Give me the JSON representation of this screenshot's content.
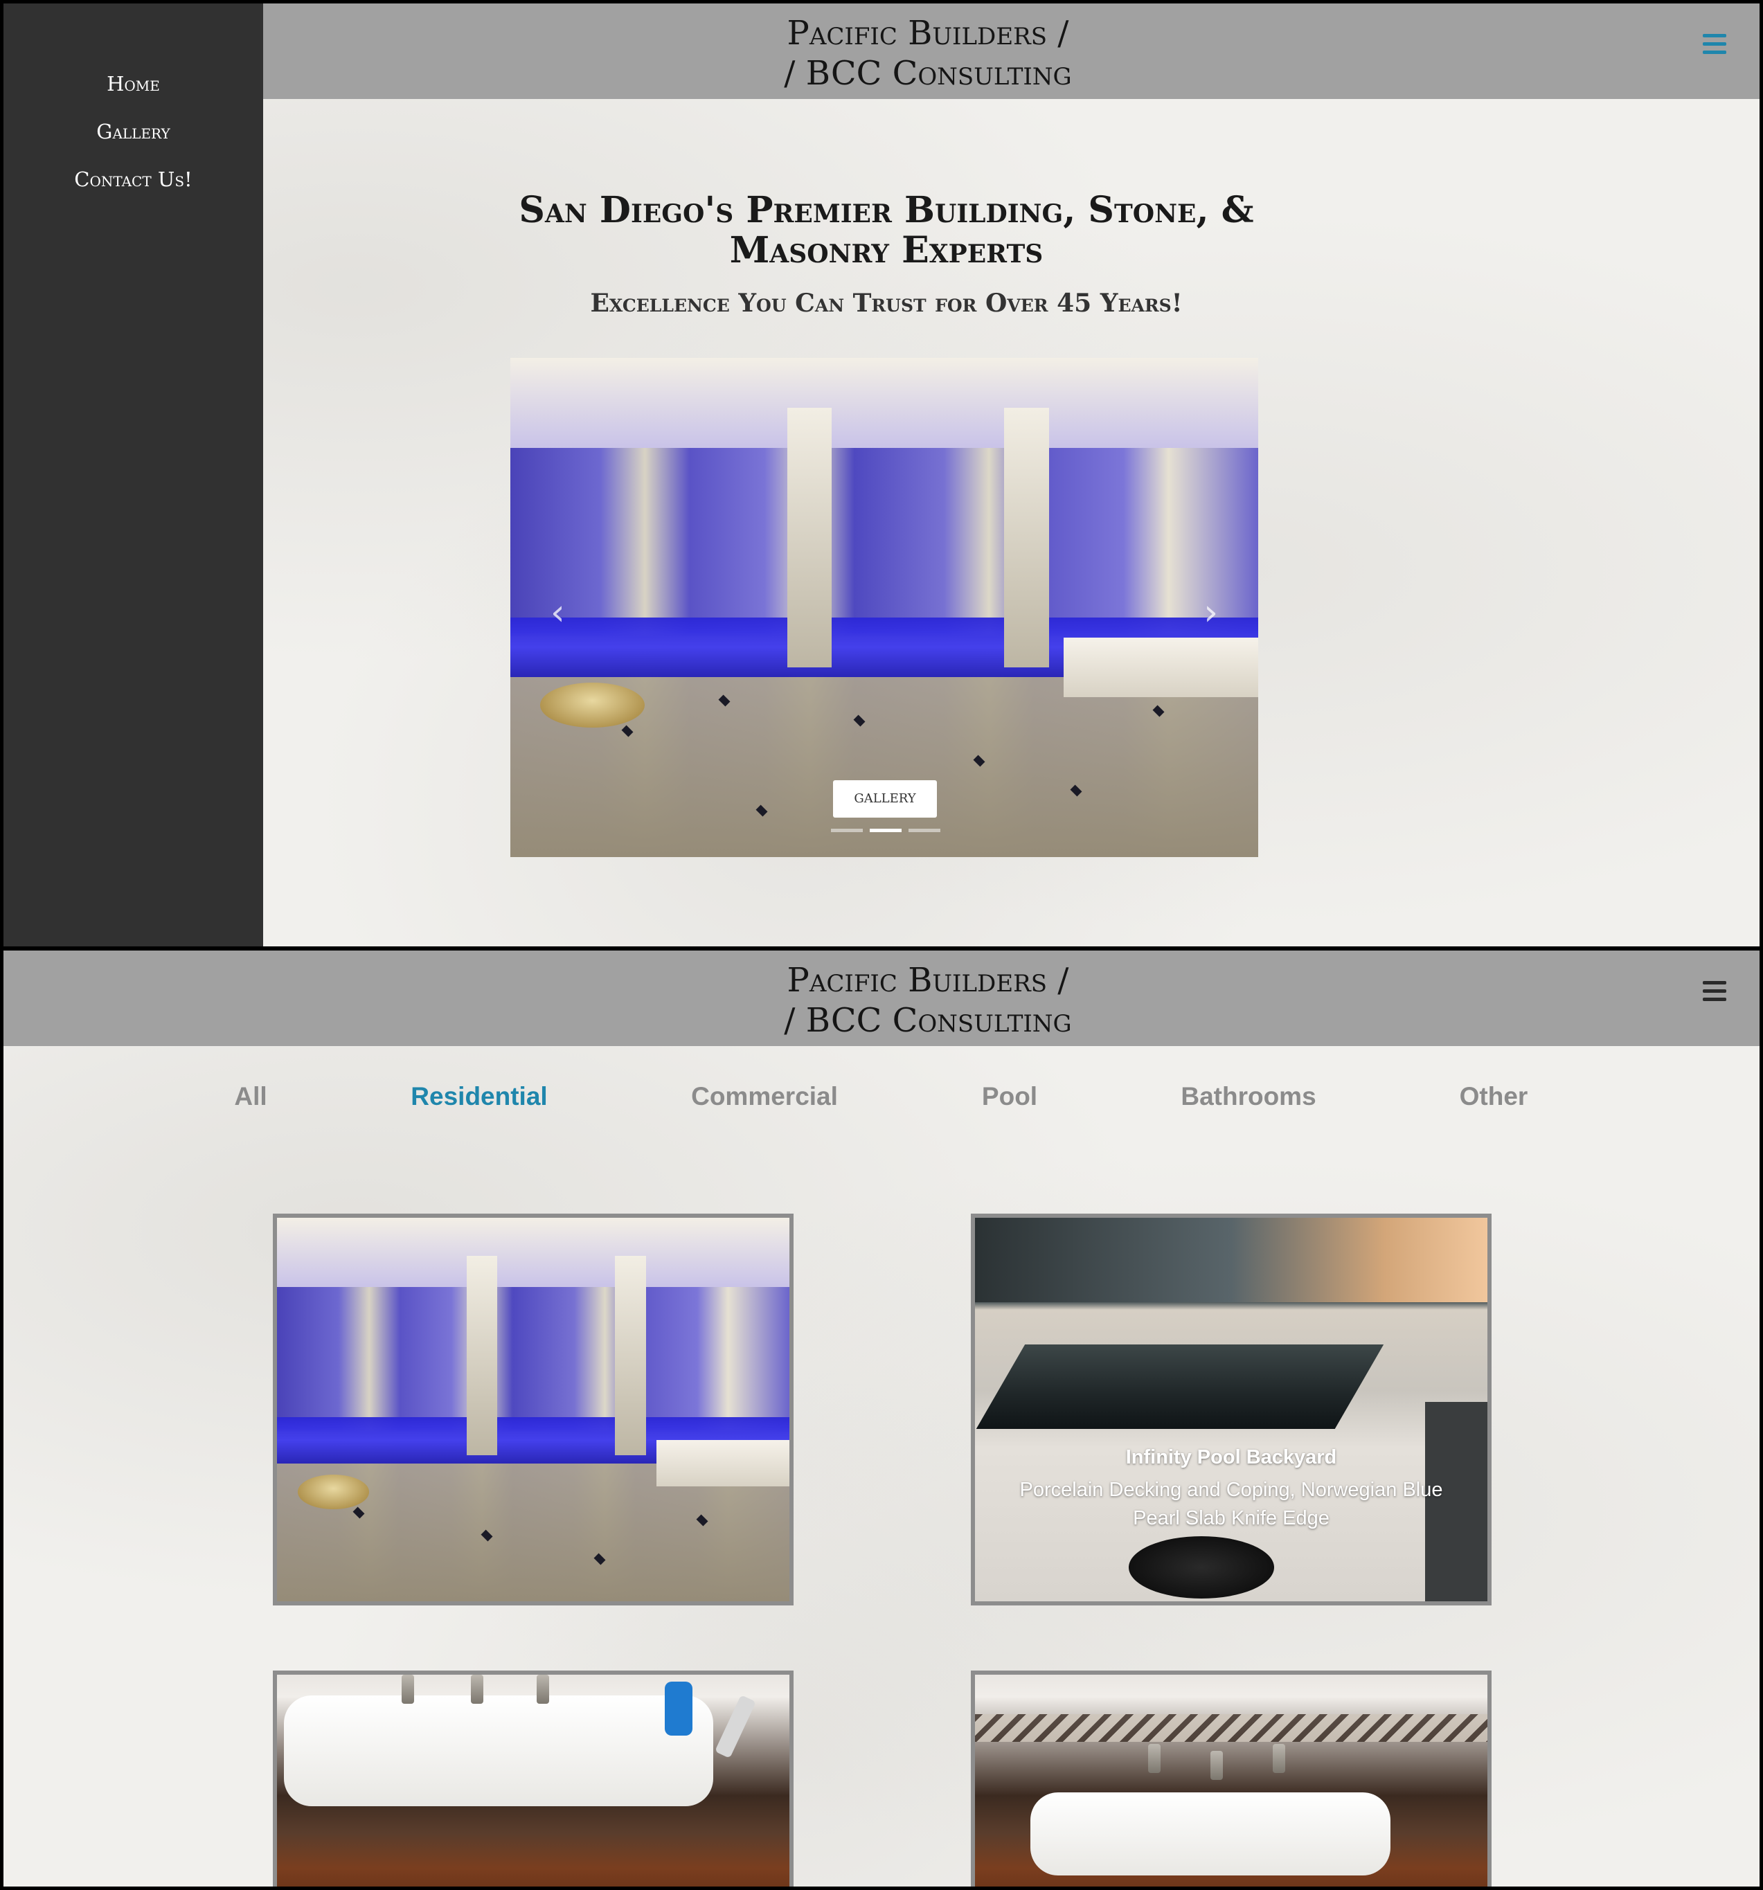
{
  "site": {
    "brand_line1": "Pacific Builders /",
    "brand_line2": "/ BCC Consulting"
  },
  "sidebar": {
    "items": [
      {
        "label": "Home"
      },
      {
        "label": "Gallery"
      },
      {
        "label": "Contact Us!"
      }
    ]
  },
  "home": {
    "title": "San Diego's Premier Building, Stone, & Masonry Experts",
    "subtitle": "Excellence You Can Trust for Over 45 Years!",
    "carousel": {
      "cta_label": "GALLERY",
      "slide_count": 3,
      "active_slide": 2
    }
  },
  "gallery": {
    "filters": [
      "All",
      "Residential",
      "Commercial",
      "Pool",
      "Bathrooms",
      "Other"
    ],
    "active_filter": "Residential",
    "cards": [
      {
        "title": "",
        "caption": ""
      },
      {
        "title": "Infinity Pool Backyard",
        "caption": "Porcelain Decking and Coping, Norwegian Blue Pearl Slab Knife Edge"
      },
      {
        "title": "",
        "caption": ""
      },
      {
        "title": "",
        "caption": ""
      }
    ]
  },
  "icons": {
    "menu": "hamburger-icon",
    "prev": "chevron-left-icon",
    "next": "chevron-right-icon"
  },
  "colors": {
    "sidebar_bg": "#313131",
    "header_bg": "#a1a1a1",
    "accent": "#1f86ac",
    "menu_icon_active": "#1f86ac",
    "menu_icon_default": "#2a2a2a",
    "filter_inactive": "#8b8b8b"
  }
}
